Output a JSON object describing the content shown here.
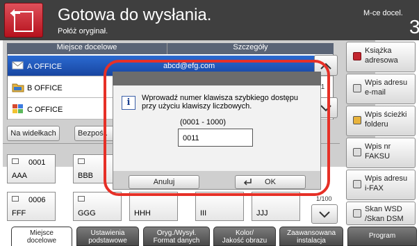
{
  "header": {
    "title": "Gotowa do wysłania.",
    "subtitle": "Połóż oryginał.",
    "copies_label": "M-ce docel.",
    "copies_value": "3"
  },
  "table": {
    "headers": [
      "Miejsce docelowe",
      "Szczegóły"
    ],
    "rows": [
      {
        "name": "A OFFICE",
        "detail": "abcd@efg.com",
        "num": ""
      },
      {
        "name": "B OFFICE",
        "detail": "",
        "num": "/1"
      },
      {
        "name": "C OFFICE",
        "detail": "",
        "num": ""
      }
    ]
  },
  "side_buttons": [
    {
      "label1": "Książka",
      "label2": "adresowa"
    },
    {
      "label1": "Wpis adresu",
      "label2": "e-mail"
    },
    {
      "label1": "Wpis ścieżki",
      "label2": "folderu"
    },
    {
      "label1": "Wpis nr",
      "label2": "FAKSU"
    },
    {
      "label1": "Wpis adresu",
      "label2": "i-FAX"
    },
    {
      "label1": "Skan WSD",
      "label2": "/Skan DSM"
    }
  ],
  "mid": {
    "hold": "Na widełkach",
    "direct": "Bezpośr."
  },
  "keys": [
    {
      "num": "0001",
      "name": "AAA"
    },
    {
      "num": "",
      "name": "BBB"
    },
    {
      "num": "0006",
      "name": "FFF"
    },
    {
      "num": "",
      "name": "GGG"
    },
    {
      "num": "",
      "name": "HHH"
    },
    {
      "num": "",
      "name": "III"
    },
    {
      "num": "",
      "name": "JJJ"
    }
  ],
  "page_indicator": "1/100",
  "dialog": {
    "message": "Wprowadź numer klawisza szybkiego dostępu przy użyciu klawiszy liczbowych.",
    "range": "(0001 - 1000)",
    "value": "0011",
    "cancel": "Anuluj",
    "ok": "OK"
  },
  "tabs": [
    {
      "line1": "Miejsce",
      "line2": "docelowe"
    },
    {
      "line1": "Ustawienia",
      "line2": "podstawowe"
    },
    {
      "line1": "Oryg./Wysył.",
      "line2": "Format danych"
    },
    {
      "line1": "Kolor/",
      "line2": "Jakość obrazu"
    },
    {
      "line1": "Zaawansowana",
      "line2": "instalacja"
    },
    {
      "line1": "Program",
      "line2": ""
    }
  ],
  "colors": {
    "header_bg": "#3f3f3f",
    "accent_red": "#e63027",
    "selected_row": "#2b6ad1"
  },
  "icons": [
    "home-icon",
    "email-icon",
    "folder-icon",
    "group-icon",
    "info-icon",
    "address-book-icon",
    "enter-icon",
    "up-arrow-icon",
    "down-arrow-icon"
  ]
}
